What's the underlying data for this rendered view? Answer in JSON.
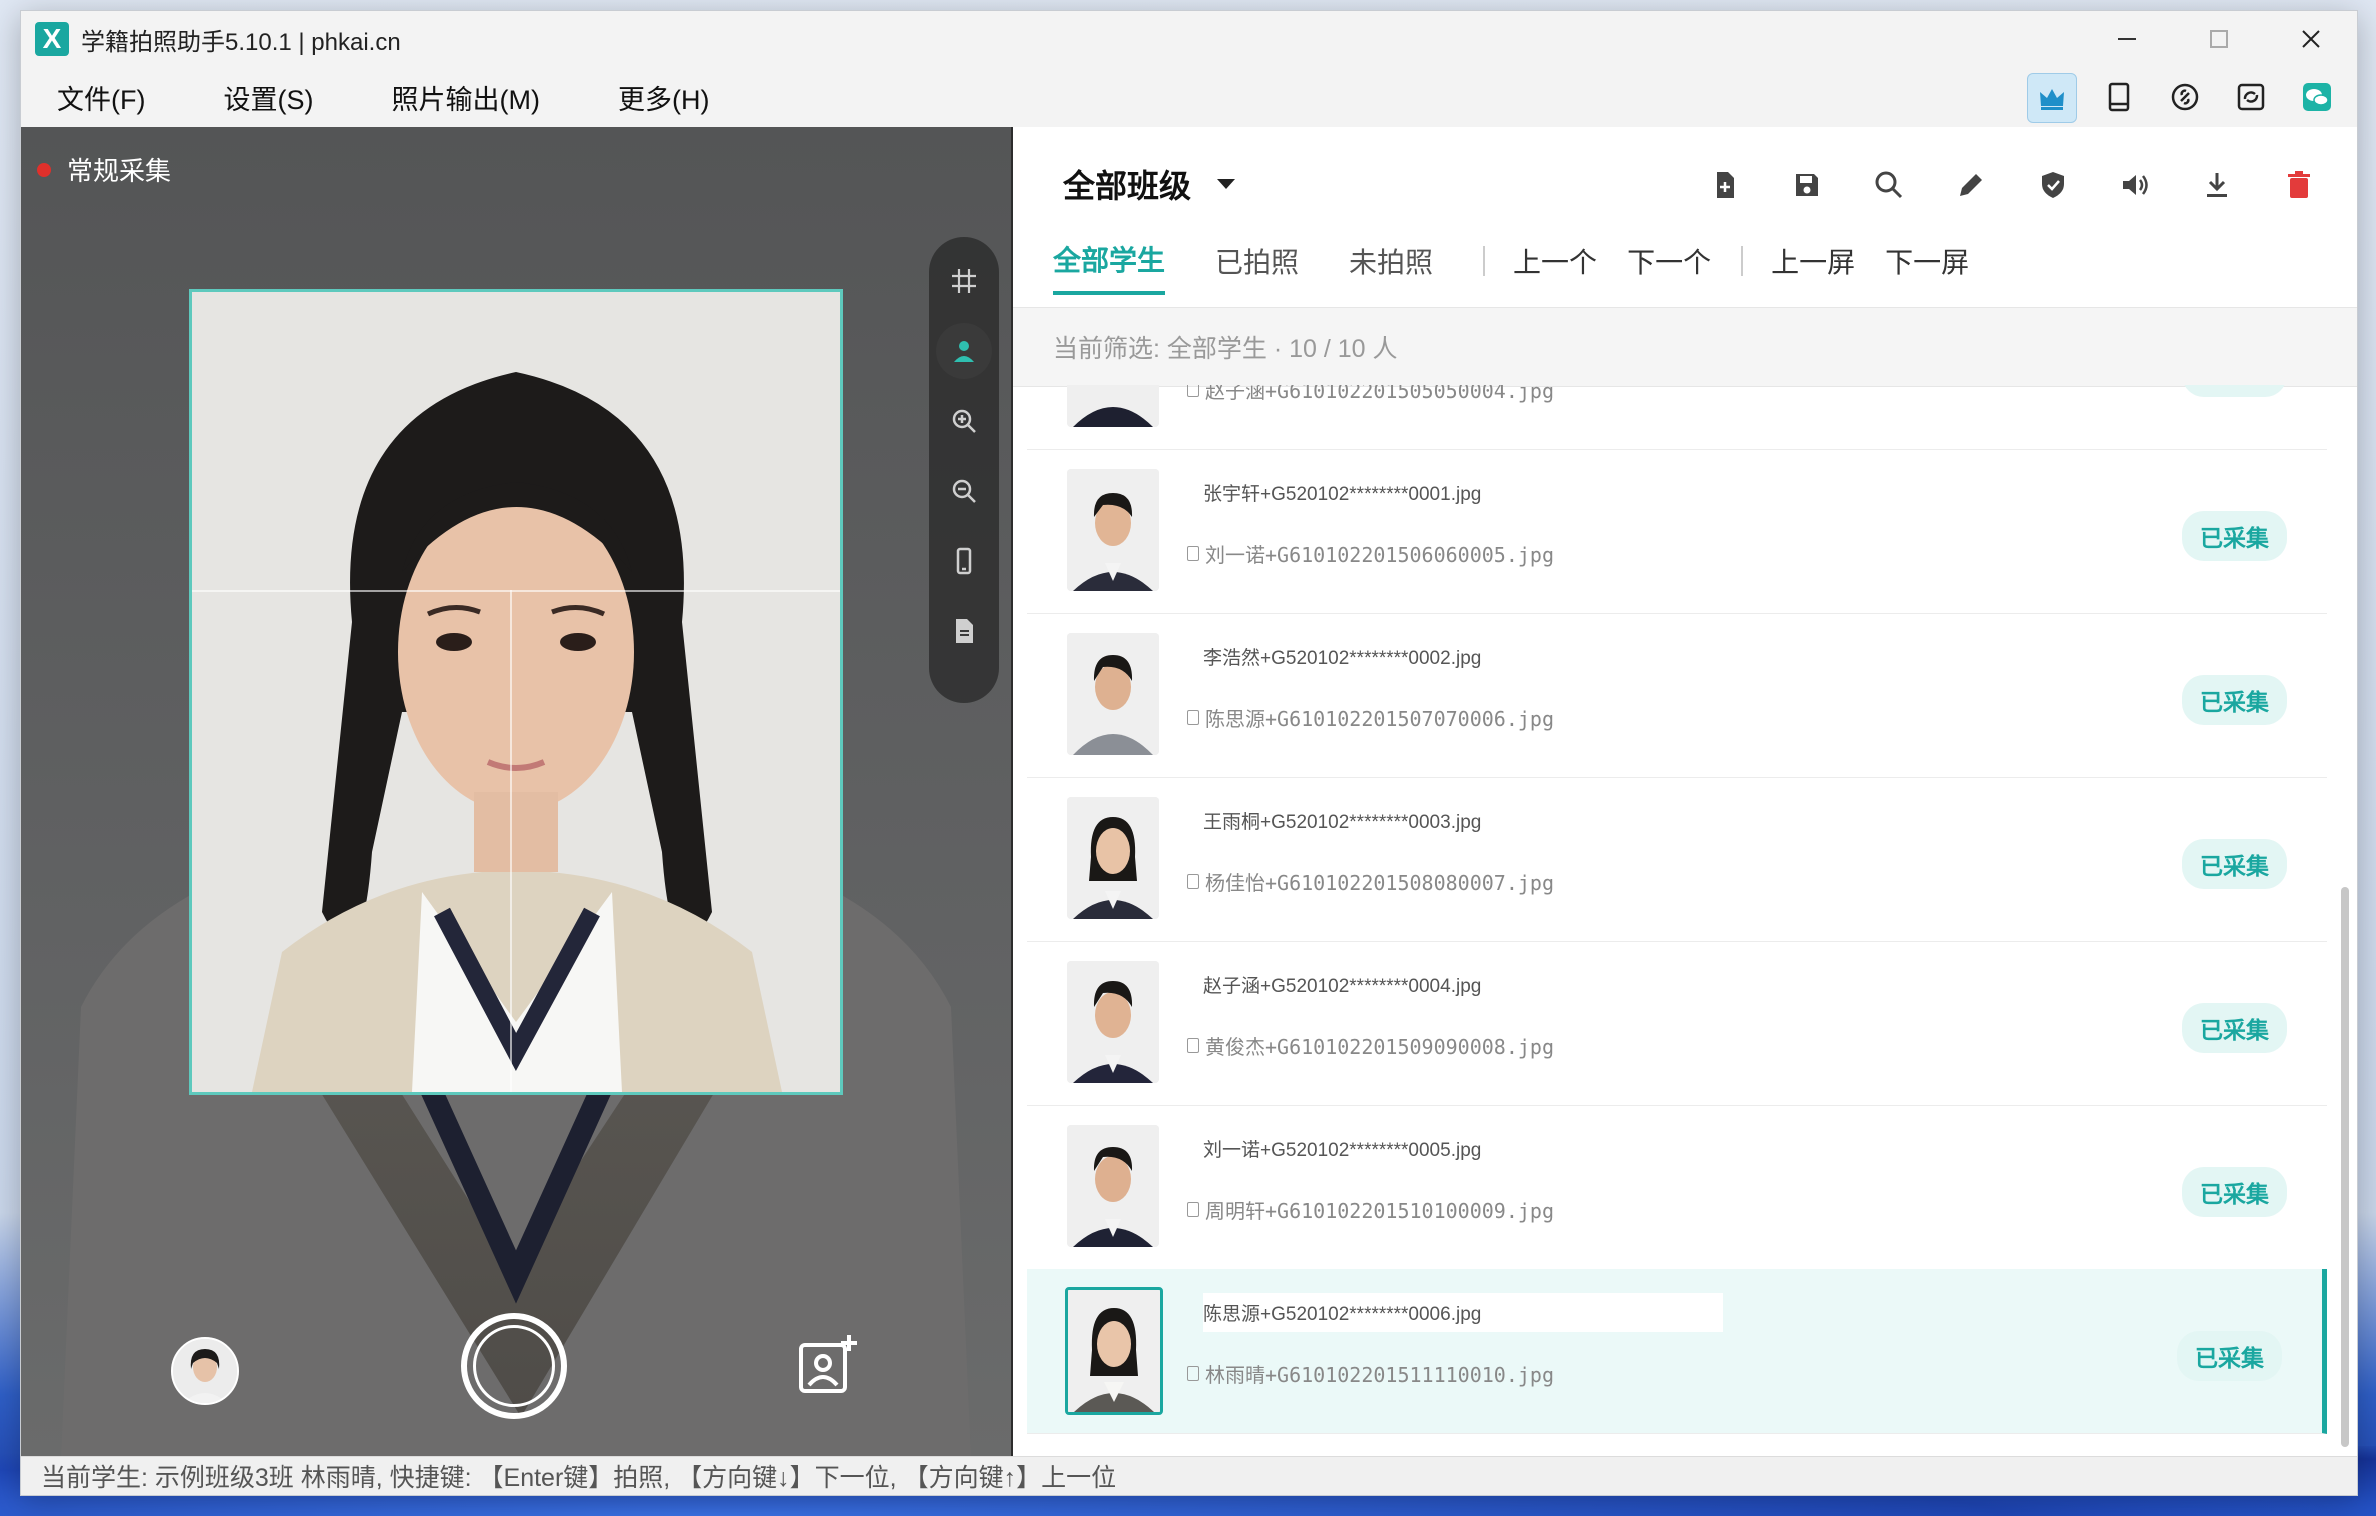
{
  "window": {
    "title": "学籍拍照助手5.10.1 | phkai.cn",
    "logo": "X"
  },
  "menu": [
    "文件(F)",
    "设置(S)",
    "照片输出(M)",
    "更多(H)"
  ],
  "top_icons": [
    "crown-icon",
    "tablet-icon",
    "link-icon",
    "sync-icon",
    "wechat-icon"
  ],
  "camera": {
    "mode_label": "常规采集"
  },
  "right_panel": {
    "class_select": "全部班级",
    "toolbar_icons": [
      "file-add-icon",
      "save-icon",
      "search-icon",
      "edit-icon",
      "shield-icon",
      "volume-icon",
      "download-icon",
      "delete-icon"
    ],
    "tabs": [
      "全部学生",
      "已拍照",
      "未拍照"
    ],
    "nav": [
      "上一个",
      "下一个",
      "上一屏",
      "下一屏"
    ],
    "filter_text": "当前筛选: 全部学生 · 10 / 10 人",
    "students": [
      {
        "id_line": "",
        "file": "赵子涵+G610102201505050004.jpg",
        "status": "已采集"
      },
      {
        "id_line": "张宇轩+G520102********0001.jpg",
        "file": "刘一诺+G610102201506060005.jpg",
        "status": "已采集"
      },
      {
        "id_line": "李浩然+G520102********0002.jpg",
        "file": "陈思源+G610102201507070006.jpg",
        "status": "已采集"
      },
      {
        "id_line": "王雨桐+G520102********0003.jpg",
        "file": "杨佳怡+G610102201508080007.jpg",
        "status": "已采集"
      },
      {
        "id_line": "赵子涵+G520102********0004.jpg",
        "file": "黄俊杰+G610102201509090008.jpg",
        "status": "已采集"
      },
      {
        "id_line": "刘一诺+G520102********0005.jpg",
        "file": "周明轩+G610102201510100009.jpg",
        "status": "已采集"
      },
      {
        "id_line": "陈思源+G520102********0006.jpg",
        "file": "林雨晴+G610102201511110010.jpg",
        "status": "已采集"
      }
    ]
  },
  "status_bar": "当前学生: 示例班级3班 林雨晴, 快捷键: 【Enter键】拍照, 【方向键↓】下一位, 【方向键↑】上一位",
  "colors": {
    "accent": "#1aa7a0",
    "danger": "#e33b3b"
  }
}
